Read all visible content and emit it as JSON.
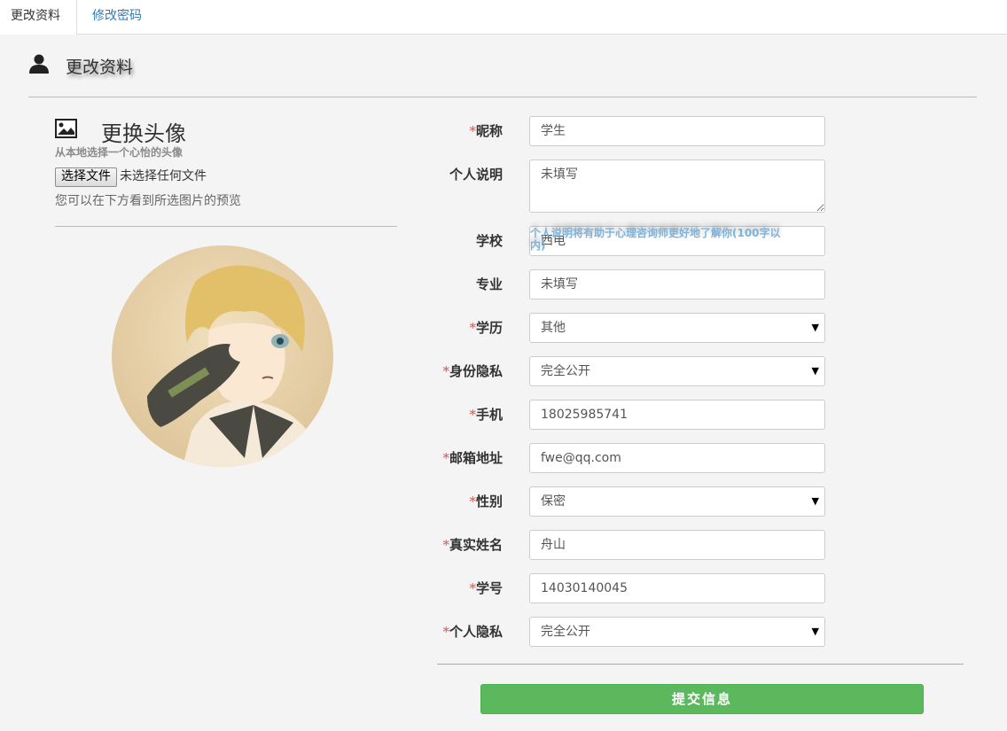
{
  "tabs": [
    {
      "label": "更改资料"
    },
    {
      "label": "修改密码"
    }
  ],
  "page": {
    "title": "更改资料"
  },
  "avatar_panel": {
    "heading": "更换头像",
    "subheading": "从本地选择一个心怡的头像",
    "file_button": "选择文件",
    "file_status": "未选择任何文件",
    "preview_hint": "您可以在下方看到所选图片的预览"
  },
  "form": {
    "fields": [
      {
        "label": "昵称",
        "required": "*",
        "value": "学生"
      },
      {
        "label": "个人说明",
        "required": "",
        "value": "未填写"
      },
      {
        "label": "学校",
        "required": "",
        "value": "西电"
      },
      {
        "label": "专业",
        "required": "",
        "value": "未填写"
      },
      {
        "label": "学历",
        "required": "*",
        "value": "其他"
      },
      {
        "label": "身份隐私",
        "required": "*",
        "value": "完全公开"
      },
      {
        "label": "手机",
        "required": "*",
        "value": "18025985741"
      },
      {
        "label": "邮箱地址",
        "required": "*",
        "value": "fwe@qq.com"
      },
      {
        "label": "性别",
        "required": "*",
        "value": "保密"
      },
      {
        "label": "真实姓名",
        "required": "*",
        "value": "舟山"
      },
      {
        "label": "学号",
        "required": "*",
        "value": "14030140045"
      },
      {
        "label": "个人隐私",
        "required": "*",
        "value": "完全公开"
      }
    ],
    "description_hint": "个人说明将有助于心理咨询师更好地了解你(100字以内)",
    "submit_label": "提交信息"
  },
  "colors": {
    "accent_link": "#337ab7",
    "required_mark": "#d9534f",
    "submit_bg": "#5cb85c"
  }
}
